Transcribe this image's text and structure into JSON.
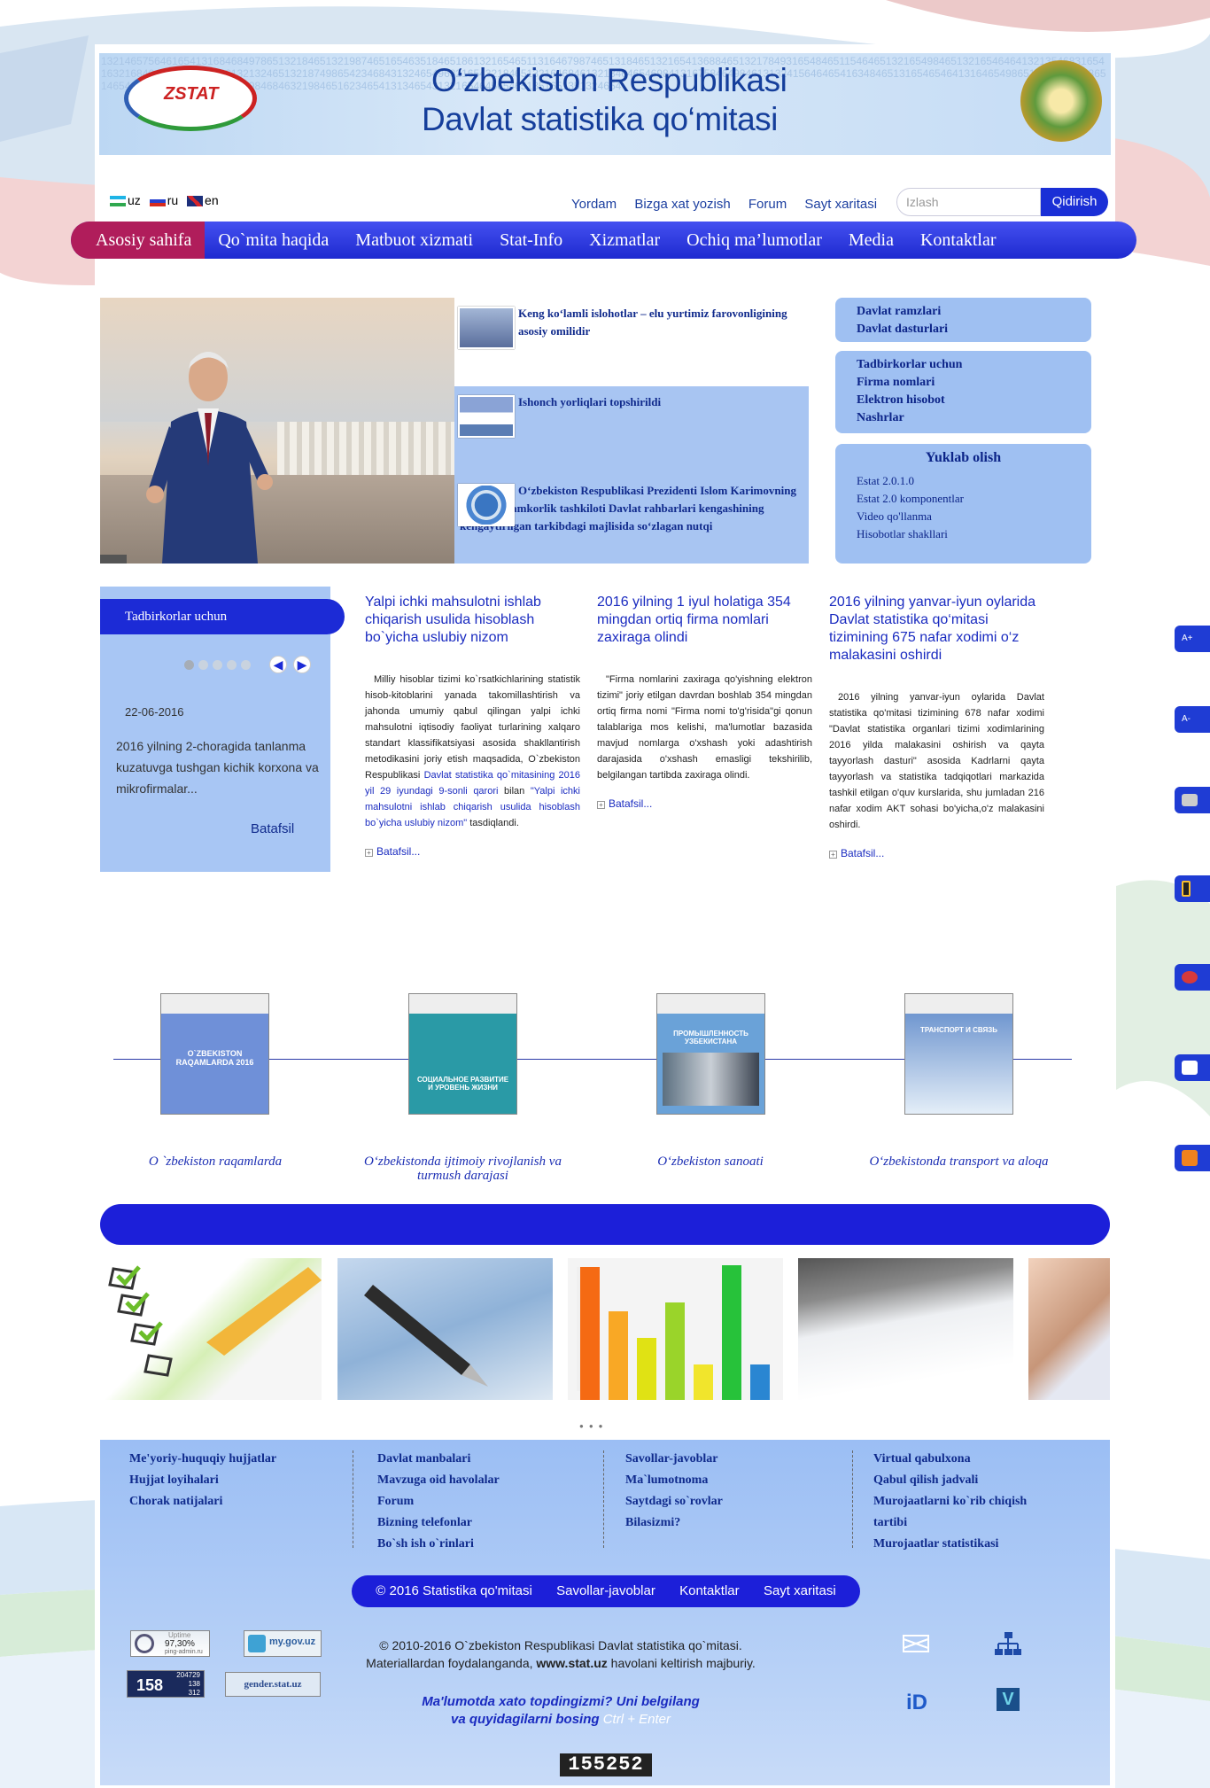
{
  "header": {
    "title_line1": "O‘zbekiston Respublikasi",
    "title_line2": "Davlat statistika qo‘mitasi",
    "logo_text": "ZSTAT"
  },
  "languages": [
    {
      "code": "uz",
      "label": "uz"
    },
    {
      "code": "ru",
      "label": "ru"
    },
    {
      "code": "en",
      "label": "en"
    }
  ],
  "toplinks": [
    "Yordam",
    "Bizga xat yozish",
    "Forum",
    "Sayt xaritasi"
  ],
  "search": {
    "placeholder": "Izlash",
    "button": "Qidirish"
  },
  "nav": [
    "Asosiy sahifa",
    "Qo`mita haqida",
    "Matbuot xizmati",
    "Stat-Info",
    "Xizmatlar",
    "Ochiq ma’lumotlar",
    "Media",
    "Kontaktlar"
  ],
  "slider_news": [
    {
      "text": "Keng ko‘lamli islohotlar – elu yurtimiz farovonligining asosiy omilidir"
    },
    {
      "text": "Ishonch yorliqlari topshirildi"
    },
    {
      "text": "O‘zbekiston Respublikasi Prezidenti Islom Karimovning Shanxay hamkorlik tashkiloti Davlat rahbarlari kengashining kengaytirilgan tarkibdagi majlisida so‘zlagan nutqi"
    }
  ],
  "right_boxes": {
    "box1": [
      "Davlat ramzlari",
      "Davlat dasturlari"
    ],
    "box2": [
      "Tadbirkorlar uchun",
      "Firma nomlari",
      "Elektron hisobot",
      "Nashrlar"
    ],
    "download_title": "Yuklab olish",
    "box3": [
      "Estat 2.0.1.0",
      "Estat 2.0 komponentlar",
      "Video qo'llanma",
      "Hisobotlar shakllari"
    ]
  },
  "entrepreneurs": {
    "header": "Tadbirkorlar uchun",
    "date": "22-06-2016",
    "text": "2016 yilning 2-choragida tanlanma kuzatuvga tushgan kichik korxona va mikrofirmalar...",
    "more": "Batafsil"
  },
  "articles": [
    {
      "title": "Yalpi ichki mahsulotni ishlab chiqarish usulida hisoblash bo`yicha uslubiy nizom",
      "body_a": "Milliy hisoblar tizimi ko`rsatkichlarining statistik hisob-kitoblarini yanada takomillashtirish va jahonda umumiy qabul qilingan yalpi ichki mahsulotni iqtisodiy faoliyat turlarining xalqaro standart klassifikatsiyasi asosida shakllantirish metodikasini joriy etish maqsadida, O`zbekiston Respublikasi ",
      "body_link": "Davlat statistika qo`mitasining 2016 yil 29 iyundagi 9-sonli qarori",
      "body_b": " bilan ",
      "body_link2": "\"Yalpi ichki mahsulotni ishlab chiqarish usulida hisoblash bo`yicha uslubiy nizom\"",
      "body_c": " tasdiqlandi.",
      "more": "Batafsil..."
    },
    {
      "title": "2016 yilning 1 iyul holatiga 354 mingdan ortiq firma nomlari zaxiraga olindi",
      "body": "\"Firma nomlarini zaxiraga qo'yishning elektron tizimi\" joriy etilgan davrdan boshlab 354 mingdan ortiq firma nomi \"Firma nomi to'g'risida\"gi qonun talablariga mos kelishi, ma'lumotlar bazasida mavjud nomlarga o'xshash yoki adashtirish darajasida o'xshash emasligi tekshirilib, belgilangan tartibda zaxiraga olindi.",
      "more": "Batafsil..."
    },
    {
      "title": "2016 yilning yanvar-iyun oylarida Davlat statistika qo‘mitasi tizimining 675 nafar xodimi o‘z malakasini oshirdi",
      "body": "2016 yilning yanvar-iyun oylarida Davlat statistika qo'mitasi tizimining 678 nafar xodimi \"Davlat statistika organlari tizimi xodimlarining 2016 yilda malakasini oshirish va qayta tayyorlash dasturi\" asosida Kadrlarni qayta tayyorlash va statistika tadqiqotlari markazida tashkil etilgan o'quv kurslarida, shu jumladan 216 nafar xodim AKT sohasi bo'yicha,o'z malakasini oshirdi.",
      "more": "Batafsil..."
    }
  ],
  "books": [
    {
      "title": "O `zbekiston raqamlarda",
      "cover_text": "O`ZBEKISTON RAQAMLARDA 2016",
      "color": "#6f90d8"
    },
    {
      "title": "O‘zbekistonda ijtimoiy rivojlanish va turmush darajasi",
      "cover_text": "СОЦИАЛЬНОЕ РАЗВИТИЕ И УРОВЕНЬ ЖИЗНИ",
      "color": "#2a9aa6"
    },
    {
      "title": "O‘zbekiston sanoati",
      "cover_text": "ПРОМЫШЛЕННОСТЬ УЗБЕКИСТАНА",
      "color": "#6aa2d8"
    },
    {
      "title": "O‘zbekistonda transport va aloqa",
      "cover_text": "ТРАНСПОРТ И СВЯЗЬ",
      "color": "#5a86c8"
    }
  ],
  "footer": {
    "col1": [
      "Me'yoriy-huquqiy hujjatlar",
      "Hujjat loyihalari",
      "Chorak natijalari"
    ],
    "col2": [
      "Davlat manbalari",
      "Mavzuga oid havolalar",
      "Forum",
      "Bizning telefonlar",
      "Bo`sh ish o`rinlari"
    ],
    "col3": [
      "Savollar-javoblar",
      "Ma`lumotnoma",
      "Saytdagi so`rovlar",
      "Bilasizmi?"
    ],
    "col4": [
      "Virtual qabulxona",
      "Qabul qilish jadvali",
      "Murojaatlarni ko`rib chiqish",
      "tartibi",
      "Murojaatlar statistikasi"
    ],
    "bar": [
      "© 2016 Statistika qo'mitasi",
      "Savollar-javoblar",
      "Kontaktlar",
      "Sayt xaritasi"
    ],
    "copyright_line1": "© 2010-2016 O`zbekiston Respublikasi Davlat statistika qo`mitasi.",
    "copyright_line2a": "Materiallardan foydalanganda, ",
    "copyright_site": "www.stat.uz",
    "copyright_line2b": " havolani keltirish majburiy.",
    "error_line1": "Ma'lumotda xato topdingizmi? Uni belgilang",
    "error_line2a": "va quyidagilarni bosing ",
    "error_keys": "Ctrl + Enter",
    "counter": "155252",
    "badges": {
      "uptime_label": "Uptime",
      "uptime_value": "97,30%",
      "uptime_site": "ping-admin.ru",
      "mygov": "my.gov.uz",
      "stats_big": "158",
      "stats_small": [
        "204729",
        "138",
        "312"
      ],
      "gender": "gender.stat.uz"
    }
  },
  "side_tabs": [
    "A+",
    "A-"
  ],
  "colors": {
    "nav": "#1e2ad0",
    "nav_active": "#b01d5b",
    "link": "#1a2bc0",
    "box": "#9fc0f2"
  }
}
